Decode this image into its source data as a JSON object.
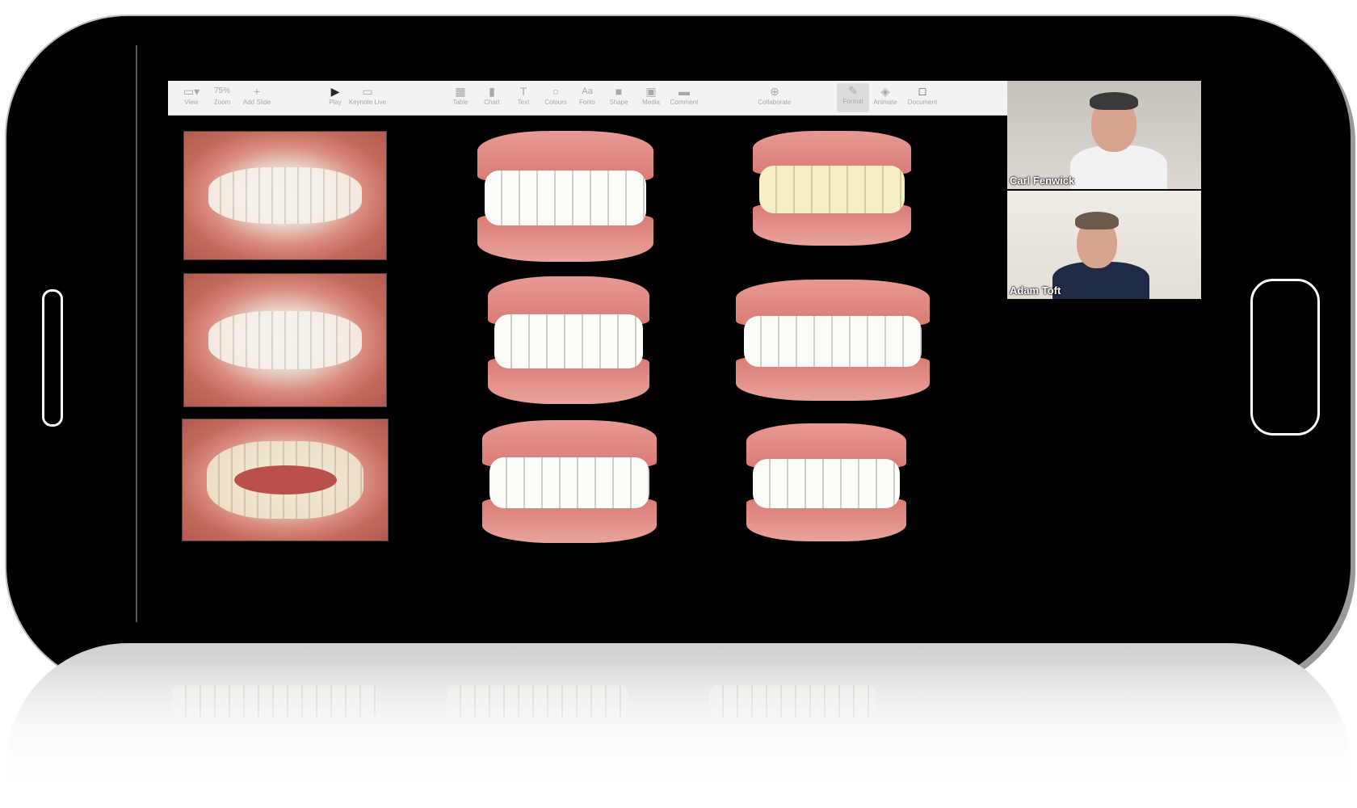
{
  "toolbar": {
    "items": [
      {
        "label": "View",
        "icon": "view-icon",
        "glyph": "▭"
      },
      {
        "label": "Zoom",
        "value": "75%",
        "icon": "zoom-icon"
      },
      {
        "label": "Add Slide",
        "icon": "plus-icon",
        "glyph": "+"
      },
      {
        "label": "Play",
        "icon": "play-icon",
        "glyph": "▶"
      },
      {
        "label": "Keynote Live",
        "icon": "keynote-live-icon",
        "glyph": "▭"
      },
      {
        "label": "Table",
        "icon": "table-icon",
        "glyph": "▦"
      },
      {
        "label": "Chart",
        "icon": "chart-icon",
        "glyph": "▮"
      },
      {
        "label": "Text",
        "icon": "text-icon",
        "glyph": "T"
      },
      {
        "label": "Colours",
        "icon": "colours-icon",
        "glyph": "○"
      },
      {
        "label": "Fonts",
        "icon": "fonts-icon",
        "glyph": "Aa"
      },
      {
        "label": "Shape",
        "icon": "shape-icon",
        "glyph": "■"
      },
      {
        "label": "Media",
        "icon": "media-icon",
        "glyph": "▣"
      },
      {
        "label": "Comment",
        "icon": "comment-icon",
        "glyph": "▬"
      },
      {
        "label": "Collaborate",
        "icon": "collaborate-icon",
        "glyph": "⊕"
      },
      {
        "label": "Format",
        "icon": "format-icon",
        "glyph": "✎"
      },
      {
        "label": "Animate",
        "icon": "animate-icon",
        "glyph": "◈"
      },
      {
        "label": "Document",
        "icon": "document-icon",
        "glyph": "□"
      }
    ]
  },
  "participants": [
    {
      "name": "Carl Fenwick"
    },
    {
      "name": "Adam Toft"
    }
  ],
  "colors": {
    "phone_body": "#000000",
    "screen_bg": "#000000",
    "toolbar_bg": "#f3f3f3",
    "gum": "#e08a83",
    "tooth": "#fbfbf7"
  }
}
